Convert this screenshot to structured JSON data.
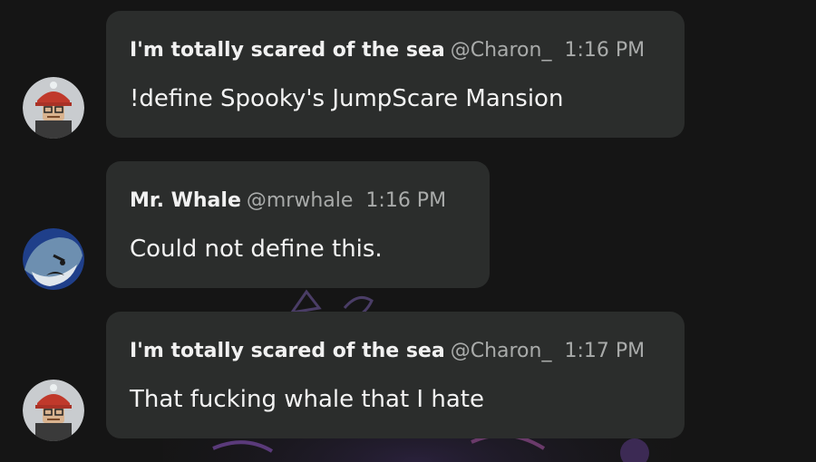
{
  "messages": [
    {
      "author": "I'm totally scared of the sea",
      "handle": "@Charon_",
      "time": "1:16 PM",
      "text": "!define Spooky's JumpScare Mansion",
      "avatar_icon": "skater-boy-avatar-icon"
    },
    {
      "author": "Mr. Whale",
      "handle": "@mrwhale",
      "time": "1:16 PM",
      "text": "Could not define this.",
      "avatar_icon": "angry-whale-avatar-icon"
    },
    {
      "author": "I'm totally scared of the sea",
      "handle": "@Charon_",
      "time": "1:17 PM",
      "text": "That fucking whale that I hate",
      "avatar_icon": "skater-boy-avatar-icon"
    }
  ],
  "colors": {
    "background": "#151515",
    "bubble": "#2b2d2c",
    "author": "#f1f1f1",
    "meta": "#a9abaa",
    "text": "#f3f3f3"
  }
}
